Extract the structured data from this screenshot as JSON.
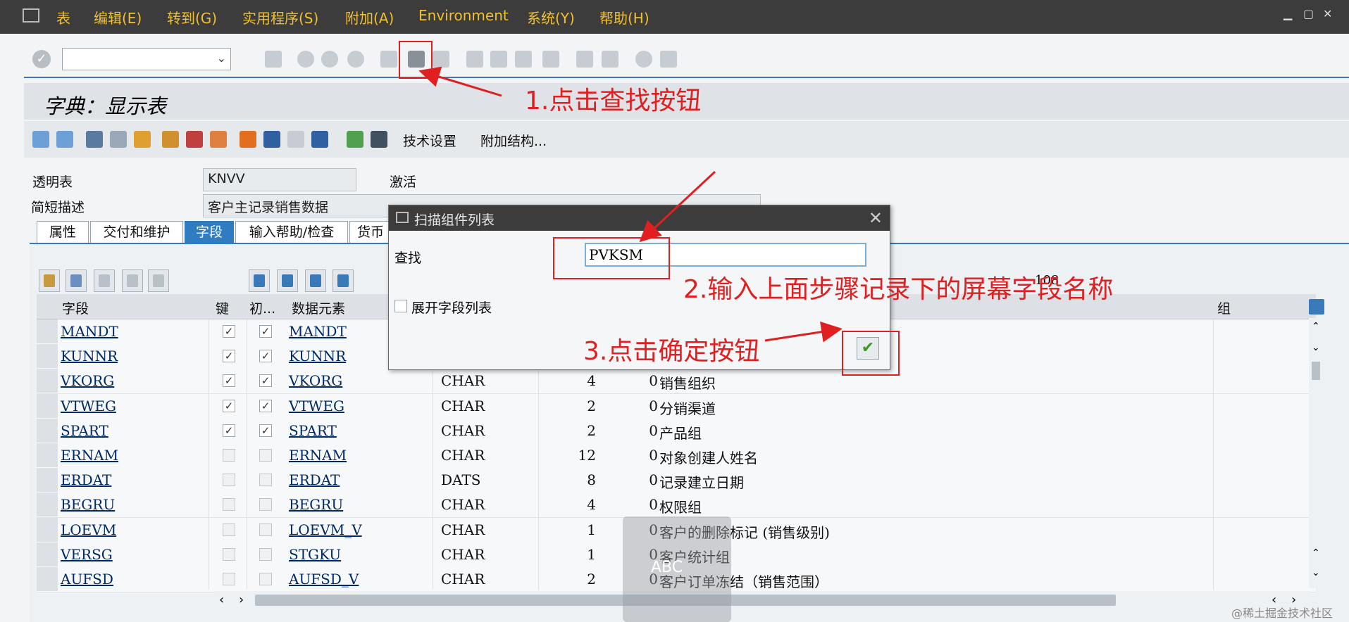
{
  "menubar": {
    "items": [
      "表",
      "编辑(E)",
      "转到(G)",
      "实用程序(S)",
      "附加(A)",
      "Environment",
      "系统(Y)",
      "帮助(H)"
    ]
  },
  "page": {
    "title": "字典：显示表"
  },
  "app_toolbar": {
    "tech_settings": "技术设置",
    "append_structure": "附加结构..."
  },
  "header": {
    "table_label": "透明表",
    "table_value": "KNVV",
    "status": "激活",
    "desc_label": "简短描述",
    "desc_value": "客户主记录销售数据"
  },
  "tabs": [
    "属性",
    "交付和维护",
    "字段",
    "输入帮助/检查",
    "货币"
  ],
  "grid": {
    "headers": {
      "field": "字段",
      "key": "键",
      "init": "初...",
      "data_element": "数据元素",
      "group": "组"
    },
    "rows": [
      {
        "field": "MANDT",
        "key": "✓",
        "init": "✓",
        "element": "MANDT",
        "type": "",
        "length": "",
        "decimals": "",
        "desc": ""
      },
      {
        "field": "KUNNR",
        "key": "✓",
        "init": "✓",
        "element": "KUNNR",
        "type": "",
        "length": "",
        "decimals": "",
        "desc": ""
      },
      {
        "field": "VKORG",
        "key": "✓",
        "init": "✓",
        "element": "VKORG",
        "type": "CHAR",
        "length": "4",
        "decimals": "0",
        "desc": "销售组织"
      },
      {
        "field": "VTWEG",
        "key": "✓",
        "init": "✓",
        "element": "VTWEG",
        "type": "CHAR",
        "length": "2",
        "decimals": "0",
        "desc": "分销渠道"
      },
      {
        "field": "SPART",
        "key": "✓",
        "init": "✓",
        "element": "SPART",
        "type": "CHAR",
        "length": "2",
        "decimals": "0",
        "desc": "产品组"
      },
      {
        "field": "ERNAM",
        "key": "",
        "init": "",
        "element": "ERNAM",
        "type": "CHAR",
        "length": "12",
        "decimals": "0",
        "desc": "对象创建人姓名"
      },
      {
        "field": "ERDAT",
        "key": "",
        "init": "",
        "element": "ERDAT",
        "type": "DATS",
        "length": "8",
        "decimals": "0",
        "desc": "记录建立日期"
      },
      {
        "field": "BEGRU",
        "key": "",
        "init": "",
        "element": "BEGRU",
        "type": "CHAR",
        "length": "4",
        "decimals": "0",
        "desc": "权限组"
      },
      {
        "field": "LOEVM",
        "key": "",
        "init": "",
        "element": "LOEVM_V",
        "type": "CHAR",
        "length": "1",
        "decimals": "0",
        "desc": "客户的删除标记 (销售级别)"
      },
      {
        "field": "VERSG",
        "key": "",
        "init": "",
        "element": "STGKU",
        "type": "CHAR",
        "length": "1",
        "decimals": "0",
        "desc": "客户统计组"
      },
      {
        "field": "AUFSD",
        "key": "",
        "init": "",
        "element": "AUFSD_V",
        "type": "CHAR",
        "length": "2",
        "decimals": "0",
        "desc": "客户订单冻结（销售范围）"
      }
    ],
    "count_fragment": "108"
  },
  "dialog": {
    "title": "扫描组件列表",
    "find_label": "查找",
    "find_value": "PVKSM",
    "expand_label": "展开字段列表"
  },
  "annotations": {
    "step1": "1.点击查找按钮",
    "step2": "2.输入上面步骤记录下的屏幕字段名称",
    "step3": "3.点击确定按钮",
    "color": "#e02020"
  },
  "overlay": {
    "abc": "ABC",
    "watermark": "@稀土掘金技术社区"
  },
  "colors": {
    "menubar": "#3c3c3c",
    "menu_text": "#f0c030",
    "accent": "#2f7cc0",
    "link": "#002a66"
  }
}
